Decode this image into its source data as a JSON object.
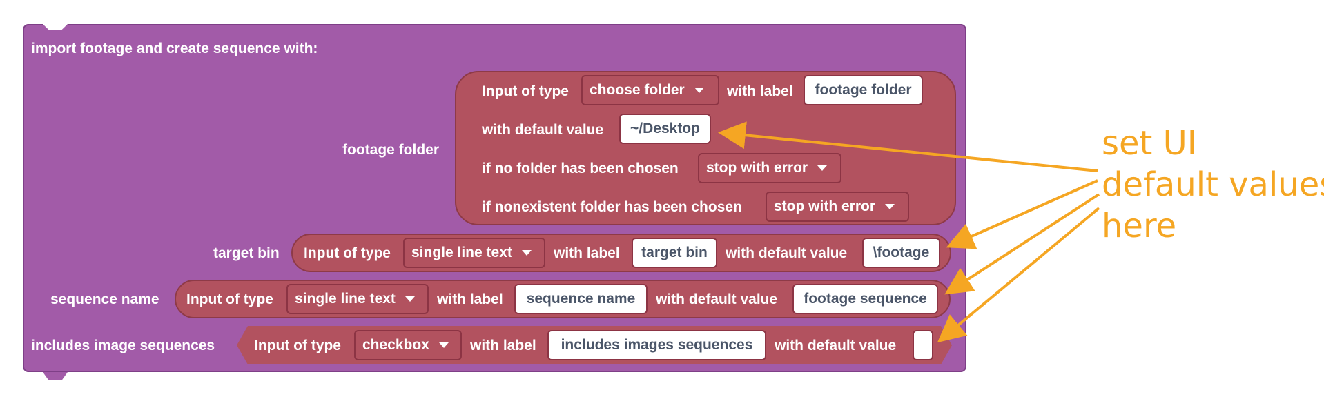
{
  "main_block": {
    "title": "import footage and create sequence  with:",
    "footage_folder": {
      "label": "footage folder",
      "input_of_type": "Input of type",
      "type_value": "choose folder",
      "with_label": "with label",
      "label_value": "footage folder",
      "with_default_value": "with default value",
      "default_value": "~/Desktop",
      "no_folder_text": "if no folder has been chosen",
      "no_folder_value": "stop with error",
      "nonexistent_text": "if nonexistent folder has been chosen",
      "nonexistent_value": "stop with error"
    },
    "target_bin": {
      "label": "target bin",
      "input_of_type": "Input of type",
      "type_value": "single line text",
      "with_label": "with label",
      "label_value": "target bin",
      "with_default_value": "with default value",
      "default_value": "\\footage"
    },
    "sequence_name": {
      "label": "sequence name",
      "input_of_type": "Input of type",
      "type_value": "single line text",
      "with_label": "with label",
      "label_value": "sequence name",
      "with_default_value": "with default value",
      "default_value": "footage sequence"
    },
    "image_sequences": {
      "label": "includes image sequences",
      "input_of_type": "Input of type",
      "type_value": "checkbox",
      "with_label": "with label",
      "label_value": "includes images sequences",
      "with_default_value": "with default value",
      "default_value": ""
    }
  },
  "annotation": {
    "line1": "set UI",
    "line2": "default values",
    "line3": "here",
    "color": "#f5a623"
  },
  "colors": {
    "main_block": "#a25ba8",
    "input_block": "#b2525f"
  },
  "icons": {
    "dropdown": "caret-down-icon"
  }
}
